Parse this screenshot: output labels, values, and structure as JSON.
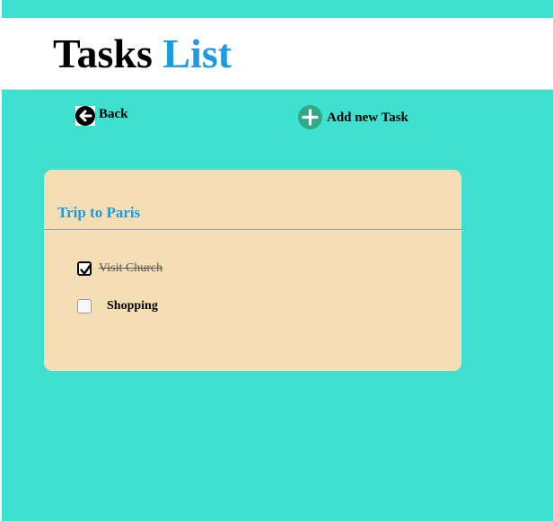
{
  "header": {
    "title_word1": "Tasks",
    "title_word2": "List"
  },
  "toolbar": {
    "back_label": "Back",
    "back_icon": "arrow-left-circle-icon",
    "add_label": "Add new Task",
    "add_icon": "plus-circle-icon"
  },
  "list": {
    "title": "Trip to Paris",
    "tasks": [
      {
        "label": "Visit Church",
        "done": true
      },
      {
        "label": "Shopping",
        "done": false
      }
    ]
  },
  "colors": {
    "page_background": "#40e0d0",
    "accent_blue": "#1e9be0",
    "card_background": "#f5deb3",
    "add_icon_green": "#2eaa85"
  }
}
